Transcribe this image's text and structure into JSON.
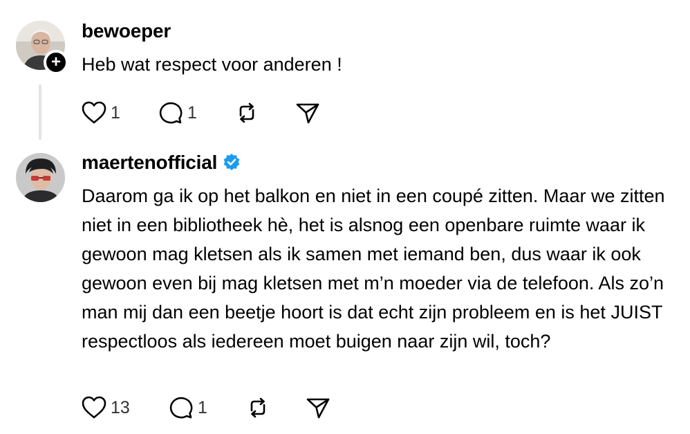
{
  "posts": [
    {
      "username": "bewoeper",
      "text": "Heb wat respect voor anderen !",
      "likes": "1",
      "replies": "1",
      "avatar_icon": "person-photo-avatar",
      "follow_icon": "plus-icon"
    },
    {
      "username": "maertenofficial",
      "verified": true,
      "verified_color": "#1d9bf0",
      "text": "Daarom ga ik op het balkon en niet in een coupé zitten. Maar we zitten niet in een bibliotheek hè, het is alsnog een openbare ruimte waar ik gewoon mag kletsen als ik samen met iemand ben, dus waar ik ook gewoon even bij mag kletsen met m’n moeder via de telefoon. Als zo’n man mij dan een beetje hoort is dat echt zijn probleem en is het JUIST respectloos als iedereen moet buigen naar zijn wil, toch?",
      "likes": "13",
      "replies": "1",
      "avatar_icon": "person-photo-avatar"
    }
  ],
  "icons": {
    "like": "heart-icon",
    "reply": "speech-bubble-icon",
    "repost": "repost-icon",
    "share": "paper-plane-icon",
    "verified": "verified-badge-icon"
  }
}
